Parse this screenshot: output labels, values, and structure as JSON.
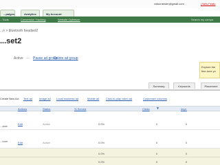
{
  "top_bar": {
    "account_email": "vidsontester@gmail.com",
    "new_feature": "| New Featu"
  },
  "tabs": {
    "campaigns": "...paigns",
    "analytics": "Analytics",
    "my_account": "My Account"
  },
  "sub_nav": {
    "tools": "...Tools",
    "conversion_tracking": "Conversion Tracking",
    "website_optimizer": "Website Optimizer",
    "search_help": "Search my campa"
  },
  "breadcrumb": {
    "prefix": "...n >",
    "current": "bluetooth headset2"
  },
  "group": {
    "title": "...set2",
    "status": "Active",
    "separator": "—",
    "pause_link": "Pause ad group",
    "delete_link": "Delete ad group"
  },
  "info_box": {
    "line1": "Explore the",
    "line2": "fine-tune yo"
  },
  "section_tabs": {
    "summary": "Summary",
    "keywords": "Keywords",
    "placements": "Placement"
  },
  "toolbar": {
    "create_new_ad": "Create New Ad:",
    "text_ad": "Text ad",
    "image_ad": "Image ad",
    "local_business_ad": "Local business ad",
    "mobile_ad": "Mobile ad",
    "click_to_play": "Click-to-play video ad",
    "customize": "Customize columns"
  },
  "table": {
    "headers": {
      "actions": "Actions",
      "status": "Status",
      "pct_served": "% Served",
      "clicks": "Clicks",
      "impr": "Impr."
    },
    "rows": [
      {
        "ad_fragment": "...able",
        "action": "Edit",
        "status": "Active",
        "served": "0.0%",
        "clicks": "0",
        "impr": "0"
      },
      {
        "ad_fragment": "...eam",
        "action": "Edit",
        "status": "Active",
        "served": "0.0%",
        "clicks": "0",
        "impr": "0"
      }
    ],
    "totals": [
      {
        "served": "0.0%",
        "clicks": "0",
        "impr": "0"
      },
      {
        "served": "0.0%",
        "clicks": "0",
        "impr": "0"
      }
    ]
  },
  "colors": {
    "brand_green": "#3f7a48",
    "link_blue": "#2a5db0",
    "info_yellow": "#fff6c6"
  }
}
